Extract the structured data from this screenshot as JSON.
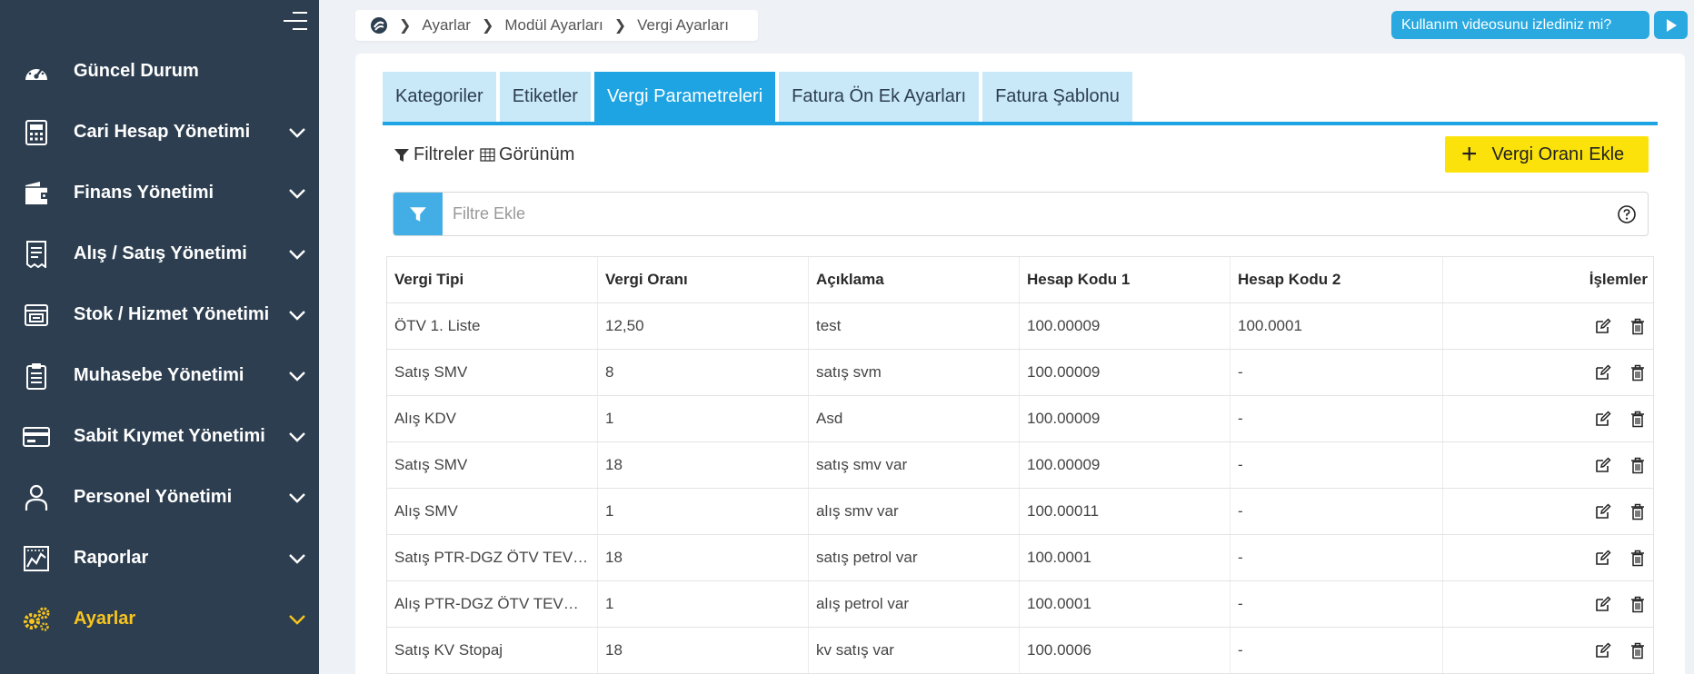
{
  "sidebar": {
    "items": [
      {
        "label": "Güncel Durum",
        "icon": "speedometer-icon",
        "has_chevron": false
      },
      {
        "label": "Cari Hesap Yönetimi",
        "icon": "calculator-icon",
        "has_chevron": true
      },
      {
        "label": "Finans Yönetimi",
        "icon": "wallet-icon",
        "has_chevron": true
      },
      {
        "label": "Alış / Satış Yönetimi",
        "icon": "receipt-icon",
        "has_chevron": true
      },
      {
        "label": "Stok / Hizmet Yönetimi",
        "icon": "box-icon",
        "has_chevron": true
      },
      {
        "label": "Muhasebe Yönetimi",
        "icon": "clipboard-icon",
        "has_chevron": true
      },
      {
        "label": "Sabit Kıymet Yönetimi",
        "icon": "card-icon",
        "has_chevron": true
      },
      {
        "label": "Personel Yönetimi",
        "icon": "person-icon",
        "has_chevron": true
      },
      {
        "label": "Raporlar",
        "icon": "chart-icon",
        "has_chevron": true
      },
      {
        "label": "Ayarlar",
        "icon": "gears-icon",
        "has_chevron": true,
        "active": true
      }
    ],
    "active_color": "#f7c51e"
  },
  "breadcrumb": {
    "items": [
      "Ayarlar",
      "Modül Ayarları",
      "Vergi Ayarları"
    ]
  },
  "video_prompt": {
    "label": "Kullanım videosunu izlediniz mi?"
  },
  "tabs": [
    {
      "label": "Kategoriler",
      "active": false
    },
    {
      "label": "Etiketler",
      "active": false
    },
    {
      "label": "Vergi Parametreleri",
      "active": true
    },
    {
      "label": "Fatura Ön Ek Ayarları",
      "active": false
    },
    {
      "label": "Fatura Şablonu",
      "active": false
    }
  ],
  "toolbar": {
    "filters_label": "Filtreler",
    "view_label": "Görünüm",
    "add_label": "Vergi Oranı Ekle"
  },
  "filter": {
    "placeholder": "Filtre Ekle",
    "value": ""
  },
  "table": {
    "headers": [
      "Vergi Tipi",
      "Vergi Oranı",
      "Açıklama",
      "Hesap Kodu 1",
      "Hesap Kodu 2",
      "İşlemler"
    ],
    "rows": [
      [
        "ÖTV 1. Liste",
        "12,50",
        "test",
        "100.00009",
        "100.0001"
      ],
      [
        "Satış SMV",
        "8",
        "satış svm",
        "100.00009",
        "-"
      ],
      [
        "Alış KDV",
        "1",
        "Asd",
        "100.00009",
        "-"
      ],
      [
        "Satış SMV",
        "18",
        "satış smv var",
        "100.00009",
        "-"
      ],
      [
        "Alış SMV",
        "1",
        "alış smv var",
        "100.00011",
        "-"
      ],
      [
        "Satış PTR-DGZ ÖTV TEVKİFATI",
        "18",
        "satış petrol var",
        "100.0001",
        "-"
      ],
      [
        "Alış PTR-DGZ ÖTV TEVKİFATI",
        "1",
        "alış petrol var",
        "100.0001",
        "-"
      ],
      [
        "Satış KV Stopaj",
        "18",
        "kv satış var",
        "100.0006",
        "-"
      ]
    ]
  },
  "colors": {
    "sidebar_bg": "#2d3e50",
    "accent_blue": "#1ea4e3",
    "add_button": "#fbe20a"
  }
}
